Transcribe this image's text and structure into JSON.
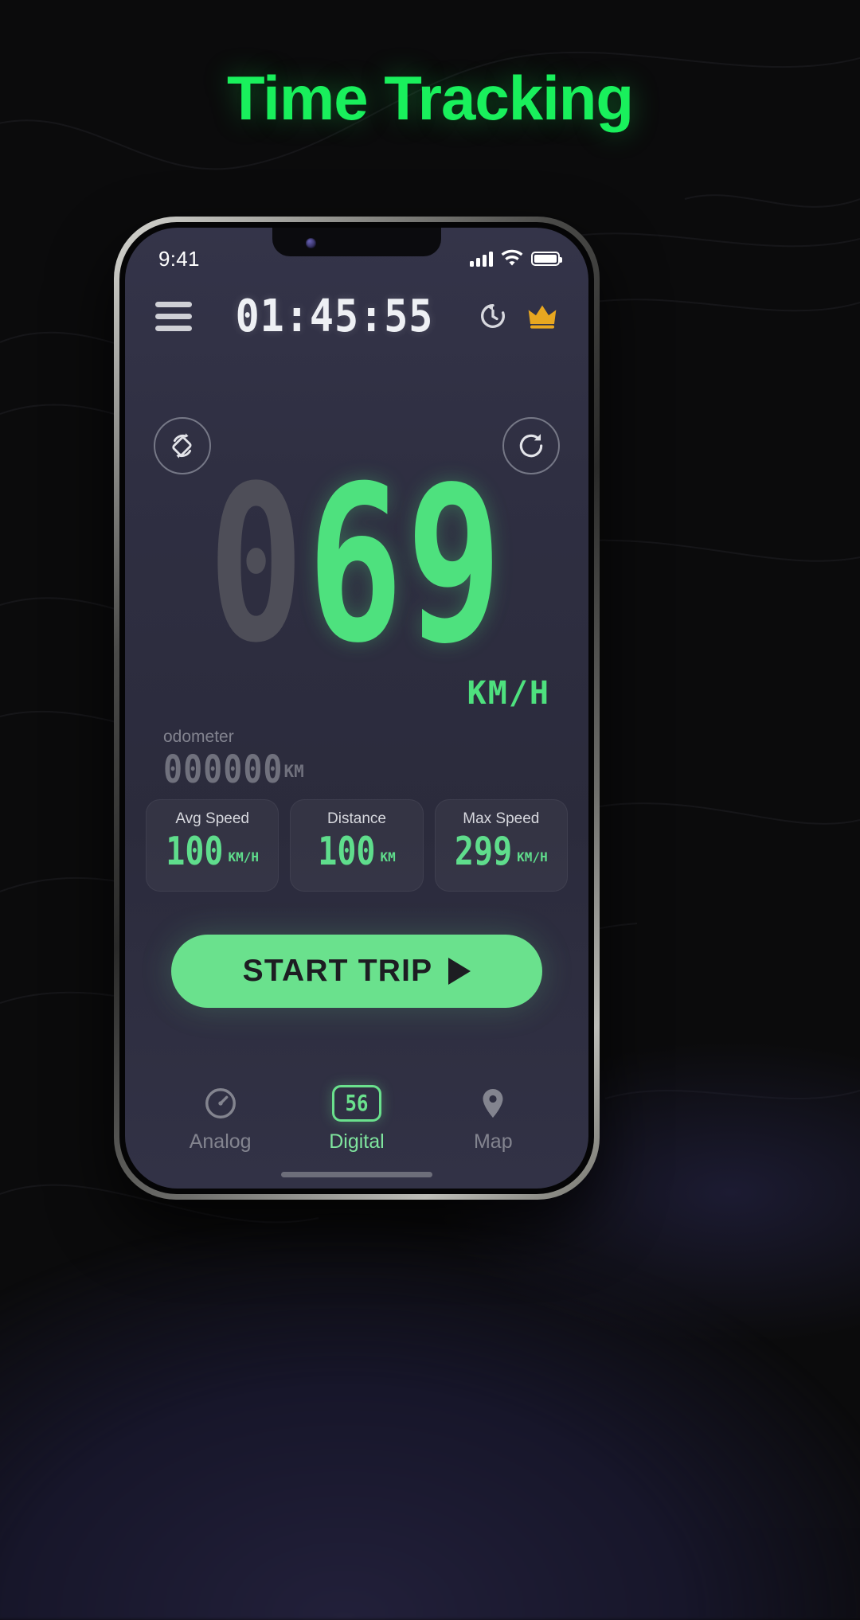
{
  "page": {
    "headline": "Time Tracking",
    "accent_green": "#19f05c",
    "screen_bg": "#2f2f42",
    "background": "#0b0b0c"
  },
  "status_bar": {
    "time": "9:41",
    "signal_icon": "cellular-signal-icon",
    "wifi_icon": "wifi-icon",
    "battery_icon": "battery-icon"
  },
  "app_header": {
    "menu_icon": "hamburger-menu-icon",
    "timer": "01:45:55",
    "history_icon": "history-icon",
    "premium_icon": "crown-icon"
  },
  "controls": {
    "rotate_screen_icon": "screen-rotation-icon",
    "reset_icon": "refresh-icon"
  },
  "speedometer": {
    "inactive_digits": "0",
    "active_digits": "69",
    "unit": "KM/H",
    "dim_color": "#4e4e58",
    "on_color": "#4ee17e"
  },
  "odometer": {
    "label": "odometer",
    "value": "000000",
    "unit": "KM"
  },
  "stats": [
    {
      "title": "Avg Speed",
      "value": "100",
      "unit": "KM/H"
    },
    {
      "title": "Distance",
      "value": "100",
      "unit": "KM"
    },
    {
      "title": "Max Speed",
      "value": "299",
      "unit": "KM/H"
    }
  ],
  "start_button": {
    "label": "START TRIP",
    "icon": "play-icon",
    "color": "#6ae18d"
  },
  "bottom_nav": [
    {
      "label": "Analog",
      "icon": "gauge-icon",
      "active": "false"
    },
    {
      "label": "Digital",
      "icon": "digital-display-icon",
      "badge": "56",
      "active": "true"
    },
    {
      "label": "Map",
      "icon": "map-pin-icon",
      "active": "false"
    }
  ]
}
